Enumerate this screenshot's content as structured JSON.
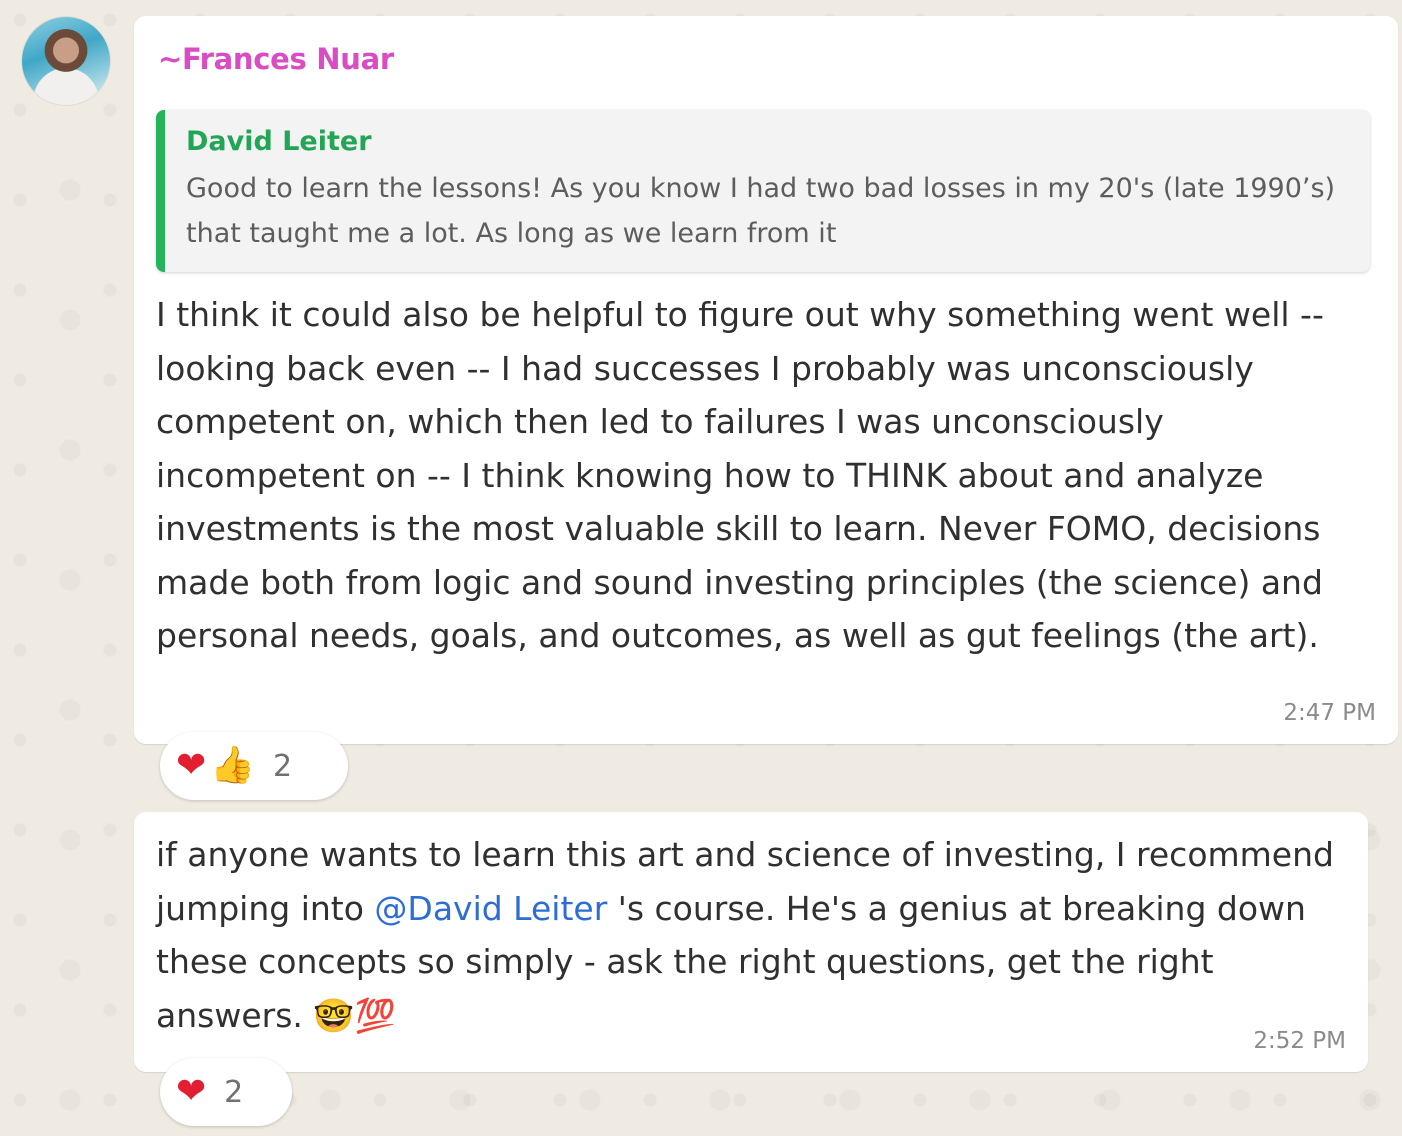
{
  "message_1": {
    "sender": "~Frances Nuar",
    "quote": {
      "author": "David Leiter",
      "text": "Good to learn the lessons! As you know I had two bad losses in my 20's (late 1990’s) that taught me a lot.  As long as we learn from it"
    },
    "text": "I think it could also be helpful to figure out why something went well -- looking back even -- I had successes I probably was unconsciously competent on, which then led to failures I was unconsciously incompetent on -- I think knowing how to THINK about and analyze investments is the most valuable skill to learn. Never FOMO, decisions made both from logic and sound investing principles (the science) and personal needs, goals, and outcomes, as well as gut feelings (the art).",
    "time": "2:47 PM",
    "reactions": {
      "emojis": [
        "❤",
        "👍"
      ],
      "count": "2"
    }
  },
  "message_2": {
    "text_before": "if anyone wants to learn this art and science of investing, I recommend jumping into ",
    "mention": "@David Leiter",
    "text_after": " 's course. He's a genius at breaking down these concepts so simply - ask the right questions, get the right answers. ",
    "emoji": "🤓💯",
    "time": "2:52 PM",
    "reactions": {
      "emojis": [
        "❤"
      ],
      "count": "2"
    }
  },
  "icons": {
    "avatar": "avatar-photo",
    "heart": "heart-icon",
    "thumb": "thumbs-up-icon"
  }
}
